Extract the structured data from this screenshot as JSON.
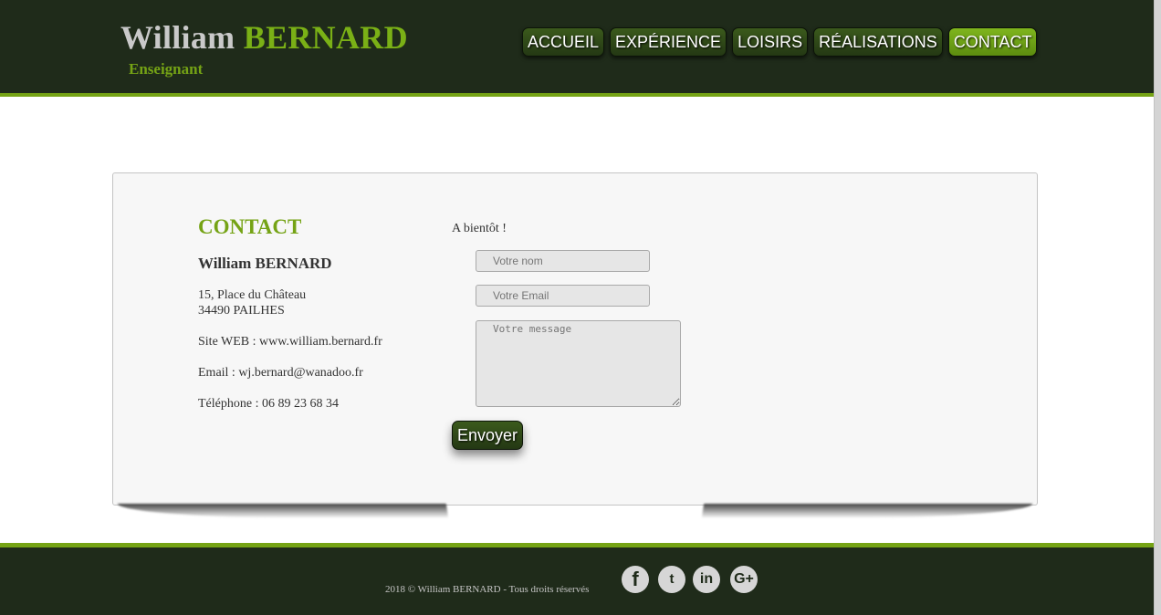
{
  "header": {
    "first_name": "William",
    "last_name": "BERNARD",
    "subtitle": "Enseignant",
    "nav": [
      {
        "label": "ACCUEIL",
        "active": false
      },
      {
        "label": "EXPÉRIENCE",
        "active": false
      },
      {
        "label": "LOISIRS",
        "active": false
      },
      {
        "label": "RÉALISATIONS",
        "active": false
      },
      {
        "label": "CONTACT",
        "active": true
      }
    ]
  },
  "contact": {
    "title": "CONTACT",
    "name": "William BERNARD",
    "address_line1": "15, Place du Château",
    "address_line2": "34490 PAILHES",
    "website": "Site WEB : www.william.bernard.fr",
    "email": "Email : wj.bernard@wanadoo.fr",
    "phone": "Téléphone : 06 89 23 68 34"
  },
  "form": {
    "greeting": "A bientôt !",
    "name_placeholder": "Votre nom",
    "email_placeholder": "Votre Email",
    "message_placeholder": "Votre message",
    "submit_label": "Envoyer"
  },
  "footer": {
    "copyright": "2018 © William BERNARD - Tous droits réservés",
    "social": [
      {
        "icon": "facebook-icon",
        "glyph": "f"
      },
      {
        "icon": "twitter-icon",
        "glyph": "t"
      },
      {
        "icon": "linkedin-icon",
        "glyph": "in"
      },
      {
        "icon": "google-plus-icon",
        "glyph": "G+"
      }
    ]
  },
  "colors": {
    "accent": "#75a315",
    "dark": "#1f2b1a"
  }
}
